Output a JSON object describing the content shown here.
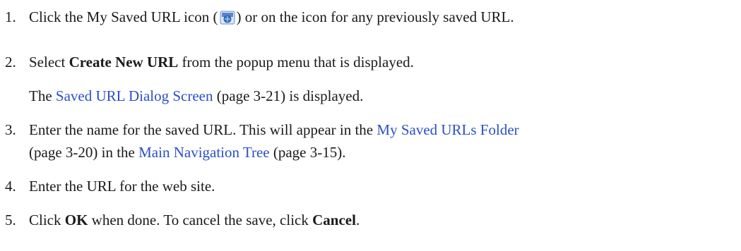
{
  "steps": [
    {
      "number": "1.",
      "pre": "Click the My Saved URL icon (",
      "icon": "saved-url-icon",
      "post": ") or on the icon for any previously saved URL."
    },
    {
      "number": "2.",
      "pre": "Select ",
      "bold": "Create New URL",
      "post": " from the popup menu that is displayed.",
      "note_pre": "The ",
      "note_link": "Saved URL Dialog Screen",
      "note_post": " (page 3-21) is displayed."
    },
    {
      "number": "3.",
      "pre": "Enter the name for the saved URL. This will appear in the ",
      "link1": "My Saved URLs Folder",
      "mid": "(page 3-20) in the ",
      "link2": "Main Navigation Tree",
      "post": " (page 3-15)."
    },
    {
      "number": "4.",
      "text": "Enter the URL for the web site."
    },
    {
      "number": "5.",
      "pre": "Click ",
      "bold1": "OK",
      "mid": " when done. To cancel the save, click ",
      "bold2": "Cancel",
      "post": "."
    }
  ],
  "colors": {
    "link": "#2b4fc7",
    "text": "#1a1a1a"
  }
}
